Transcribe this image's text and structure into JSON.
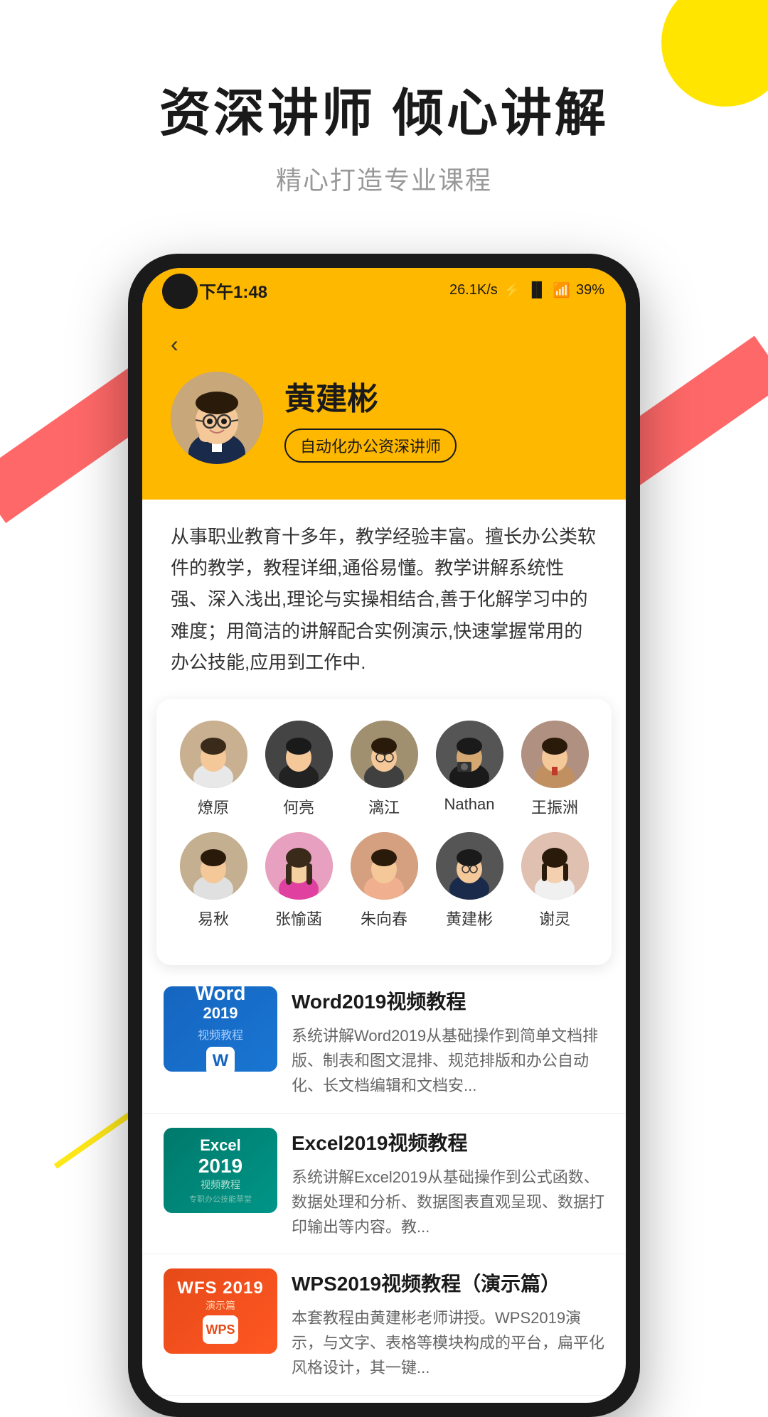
{
  "page": {
    "background": "#ffffff"
  },
  "hero": {
    "title": "资深讲师 倾心讲解",
    "subtitle": "精心打造专业课程"
  },
  "phone": {
    "statusBar": {
      "time": "下午1:48",
      "signal": "26.1K/s",
      "battery": "39%"
    },
    "teacher": {
      "name": "黄建彬",
      "badge": "自动化办公资深讲师",
      "description": "从事职业教育十多年，教学经验丰富。擅长办公类软件的教学，教程详细,通俗易懂。教学讲解系统性强、深入浅出,理论与实操相结合,善于化解学习中的难度；用简洁的讲解配合实例演示,快速掌握常用的办公技能,应用到工作中."
    },
    "instructors": {
      "row1": [
        {
          "name": "燎原",
          "avatarClass": "av-1"
        },
        {
          "name": "何亮",
          "avatarClass": "av-2"
        },
        {
          "name": "漓江",
          "avatarClass": "av-3"
        },
        {
          "name": "Nathan",
          "avatarClass": "av-4"
        },
        {
          "name": "王振洲",
          "avatarClass": "av-5"
        }
      ],
      "row2": [
        {
          "name": "易秋",
          "avatarClass": "av-6"
        },
        {
          "name": "张愉菡",
          "avatarClass": "av-7"
        },
        {
          "name": "朱向春",
          "avatarClass": "av-8"
        },
        {
          "name": "黄建彬",
          "avatarClass": "av-9"
        },
        {
          "name": "谢灵",
          "avatarClass": "av-10"
        }
      ]
    },
    "courses": [
      {
        "id": 1,
        "title": "Word2019视频教程",
        "description": "系统讲解Word2019从基础操作到简单文档排版、制表和图文混排、规范排版和办公自动化、长文档编辑和文档安...",
        "thumbType": "word",
        "thumbLabel": "Word 2019\n视频教程"
      },
      {
        "id": 2,
        "title": "Excel2019视频教程",
        "description": "系统讲解Excel2019从基础操作到公式函数、数据处理和分析、数据图表直观呈现、数据打印输出等内容。教...",
        "thumbType": "excel",
        "thumbLabel": "Excel\n2019\n视频教程"
      },
      {
        "id": 3,
        "title": "WPS2019视频教程（演示篇）",
        "description": "本套教程由黄建彬老师讲授。WPS2019演示，与文字、表格等模块构成的平台，扁平化风格设计，其一键...",
        "thumbType": "wps",
        "thumbLabel": "WPS 2019\n演示篇"
      }
    ]
  }
}
